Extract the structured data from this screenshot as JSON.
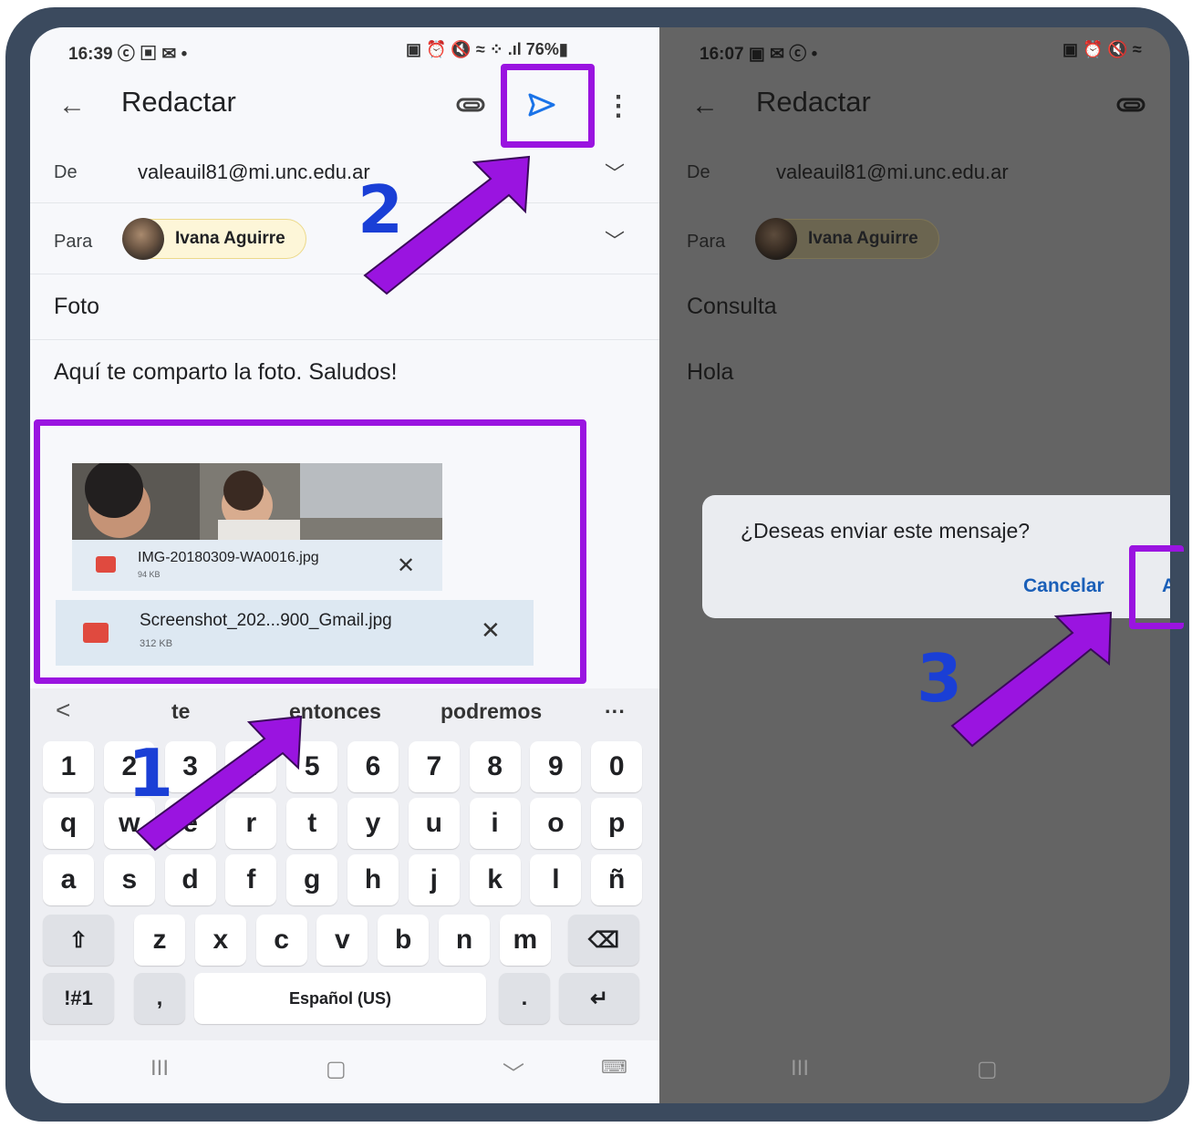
{
  "left_screen": {
    "status": {
      "time_icons": "16:39 ⓒ ▣ ✉ •",
      "right_icons": "▣ ⏰ 🔇 ≈ ⁘ .ıl 76%▮"
    },
    "app_title": "Redactar",
    "from": {
      "label": "De",
      "value": "valeauil81@mi.unc.edu.ar"
    },
    "to": {
      "label": "Para",
      "recipient": "Ivana Aguirre"
    },
    "subject": "Foto",
    "body": "Aquí te comparto la foto. Saludos!",
    "attachments": [
      {
        "name": "IMG-20180309-WA0016.jpg",
        "size": "94 KB"
      },
      {
        "name": "Screenshot_202...900_Gmail.jpg",
        "size": "312 KB"
      }
    ],
    "suggestions": [
      "te",
      "entonces",
      "podremos"
    ],
    "suggest_back": "<",
    "suggest_more": "···",
    "keyboard": {
      "row1": [
        "1",
        "2",
        "3",
        "4",
        "5",
        "6",
        "7",
        "8",
        "9",
        "0"
      ],
      "row2": [
        "q",
        "w",
        "e",
        "r",
        "t",
        "y",
        "u",
        "i",
        "o",
        "p"
      ],
      "row3": [
        "a",
        "s",
        "d",
        "f",
        "g",
        "h",
        "j",
        "k",
        "l",
        "ñ"
      ],
      "row4": [
        "z",
        "x",
        "c",
        "v",
        "b",
        "n",
        "m"
      ],
      "shift": "⇧",
      "backspace": "⌫",
      "symbols": "!#1",
      "comma": ",",
      "space": "Español (US)",
      "period": ".",
      "enter": "↵"
    },
    "nav": {
      "recents": "III",
      "home": "▢",
      "back": "﹀",
      "keyboard": "⌨"
    }
  },
  "right_screen": {
    "status": {
      "time_icons": "16:07 ▣ ✉ ⓒ •",
      "right_icons": "▣ ⏰ 🔇 ≈"
    },
    "app_title": "Redactar",
    "from": {
      "label": "De",
      "value": "valeauil81@mi.unc.edu.ar"
    },
    "to": {
      "label": "Para",
      "recipient": "Ivana Aguirre"
    },
    "subject": "Consulta",
    "body": "Hola",
    "dialog": {
      "message": "¿Deseas enviar este mensaje?",
      "cancel": "Cancelar",
      "accept_partial": "A"
    },
    "nav": {
      "recents": "III",
      "home": "▢"
    }
  },
  "steps": [
    "1",
    "2",
    "3"
  ],
  "colors": {
    "highlight": "#9a14e0",
    "step_number": "#1a3fd6",
    "frame": "#3b4a5e"
  }
}
